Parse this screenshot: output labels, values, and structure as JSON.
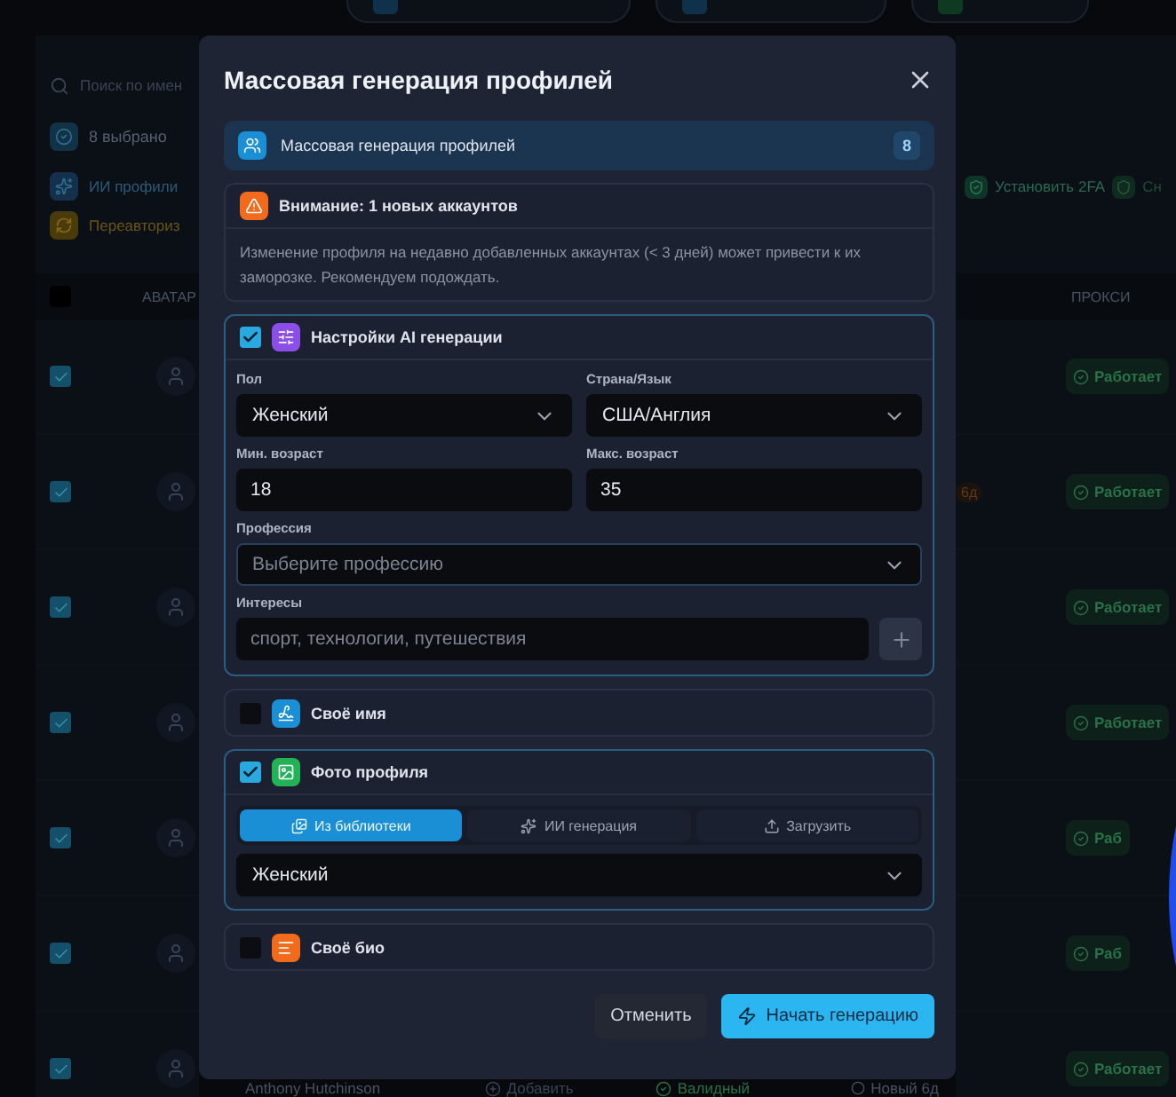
{
  "background": {
    "search": {
      "placeholder": "Поиск по имен"
    },
    "selection": {
      "label": "8 выбрано"
    },
    "actions_left": [
      "ИИ профили",
      "Переавториз"
    ],
    "actions_right": [
      "Установить 2FA",
      "Сн"
    ],
    "table": {
      "header_checked": false,
      "columns": [
        "АВАТАР",
        "ПРОКСИ"
      ],
      "rows": [
        {
          "checked": true,
          "proxy": "Работает"
        },
        {
          "checked": true,
          "proxy": "Работает",
          "tag": "6д"
        },
        {
          "checked": true,
          "proxy": "Работает"
        },
        {
          "checked": true,
          "proxy": "Работает"
        },
        {
          "checked": true,
          "proxy": "Раб"
        },
        {
          "checked": true,
          "proxy": "Раб"
        },
        {
          "checked": true,
          "proxy": "Работает"
        }
      ],
      "bottom_row": {
        "name": "Anthony Hutchinson",
        "add": "Добавить",
        "status": "Валидный",
        "new": "Новый 6д"
      }
    }
  },
  "modal": {
    "title": "Массовая генерация профилей",
    "summary": {
      "label": "Массовая генерация профилей",
      "count": "8"
    },
    "warning": {
      "title": "Внимание: 1 новых аккаунтов",
      "text": "Изменение профиля на недавно добавленных аккаунтах (< 3 дней) может привести к их заморозке. Рекомендуем подождать."
    },
    "sections": [
      {
        "kind": "ai",
        "checked": true,
        "color": "#8b4fe8",
        "title": "Настройки AI генерации",
        "fields": [
          {
            "kind": "select",
            "label": "Пол",
            "value": "Женский"
          },
          {
            "kind": "select",
            "label": "Страна/Язык",
            "value": "США/Англия"
          },
          {
            "kind": "input",
            "label": "Мин. возраст",
            "value": "18"
          },
          {
            "kind": "input",
            "label": "Макс. возраст",
            "value": "35"
          },
          {
            "kind": "select",
            "label": "Профессия",
            "placeholder": "Выберите профессию",
            "wide": true
          },
          {
            "kind": "tags",
            "label": "Интересы",
            "placeholder": "спорт, технологии, путешествия"
          }
        ]
      },
      {
        "kind": "plain",
        "checked": false,
        "color": "#1a8fd6",
        "title": "Своё имя"
      },
      {
        "kind": "photo",
        "checked": true,
        "color": "#22b357",
        "title": "Фото профиля",
        "tabs": [
          {
            "label": "Из библиотеки",
            "selected": true
          },
          {
            "label": "ИИ генерация",
            "selected": false
          },
          {
            "label": "Загрузить",
            "selected": false
          }
        ],
        "select": {
          "value": "Женский"
        }
      },
      {
        "kind": "plain",
        "checked": false,
        "color": "#f26a1b",
        "title": "Своё био"
      }
    ],
    "buttons": {
      "cancel": "Отменить",
      "start": "Начать генерацию"
    }
  }
}
